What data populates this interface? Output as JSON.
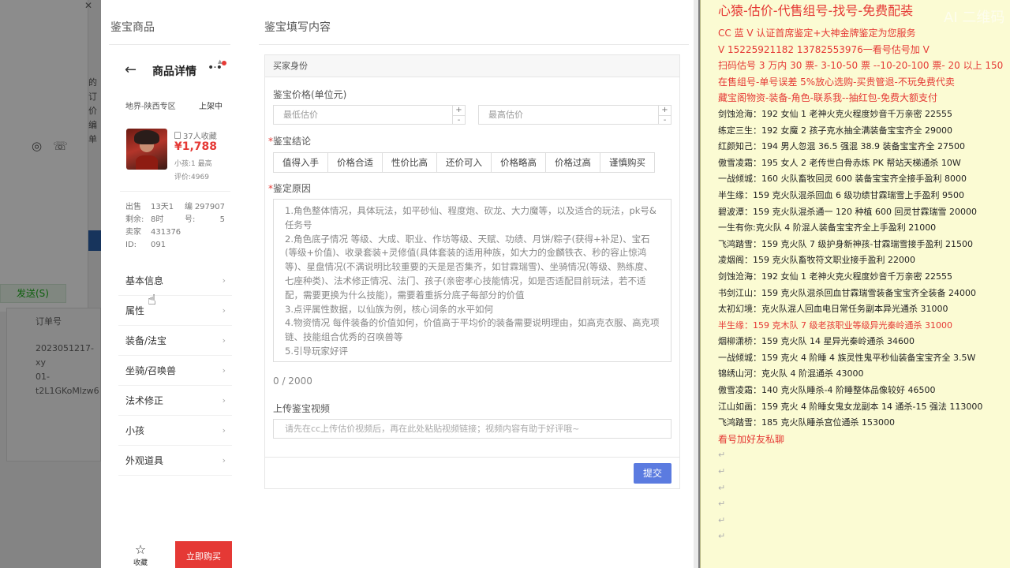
{
  "background": {
    "send_label": "发送(S)",
    "order_header": "订单号",
    "order_lines": [
      "2023051217-xy",
      "01-",
      "t2L1GKoMlzw6"
    ],
    "fragment_lines": [
      "的订",
      "",
      "",
      "价",
      "编",
      "",
      "单"
    ]
  },
  "dialog": {
    "left_title": "鉴宝商品",
    "right_title": "鉴宝填写内容",
    "phone": {
      "title": "商品详情",
      "region": "地界-陕西专区",
      "status": "上架中",
      "fav_count": "37人收藏",
      "price": "¥1,788",
      "kid_line": "小孩:1 最高",
      "score_line": "评价:4969",
      "stats": [
        {
          "a": "出售",
          "b": "13天1",
          "c": "编",
          "d": "297907"
        },
        {
          "a": "剩余:",
          "b": "8时",
          "c": "号:",
          "d": "5"
        },
        {
          "a": "卖家",
          "b": "431376",
          "c": "",
          "d": ""
        },
        {
          "a": "ID:",
          "b": "091",
          "c": "",
          "d": ""
        }
      ],
      "menu": [
        "基本信息",
        "属性",
        "装备/法宝",
        "坐骑/召唤兽",
        "法术修正",
        "小孩",
        "外观道具"
      ],
      "fav_label": "收藏",
      "buy_label": "立即购买"
    },
    "form": {
      "section_header": "买家身份",
      "price_label": "鉴宝价格(单位元)",
      "min_placeholder": "最低估价",
      "max_placeholder": "最高估价",
      "verdict_label": "鉴宝结论",
      "verdicts": [
        "值得入手",
        "价格合适",
        "性价比高",
        "还价可入",
        "价格略高",
        "价格过高",
        "谨慎购买"
      ],
      "reason_label": "鉴定原因",
      "reason_lines": [
        "1.角色整体情况，具体玩法，如平砂仙、程度炮、砍龙、大力魔等，以及适合的玩法，pk号&任务号",
        "2.角色底子情况 等级、大成、职业、作坊等级、天赋、功绩、月饼/粽子(获得+补足)、宝石(等级+价值)、收录套装+灵修值(具体套装的适用种族，如大力的金麟铁衣、秒的容止惊鸿等)、星盘情况(不满说明比较重要的天是是否集齐，如甘霖瑞雪)、坐骑情况(等级、熟练度、七座种类)、法术修正情况、法门、孩子(亲密孝心技能情况，如是否适配目前玩法，若不适配，需要更换为什么技能)，需要着重拆分底子每部分的价值",
        "3.点评属性数据，以仙族为例，核心词条的水平如何",
        "4.物资情况 每件装备的价值如何，价值高于平均价的装备需要说明理由，如高克衣服、高克项链、技能组合优秀的召唤兽等",
        "5.引导玩家好评"
      ],
      "counter": "0 / 2000",
      "video_label": "上传鉴宝视频",
      "video_placeholder": "请先在cc上传估价视频后，再在此处粘贴视频链接；视频内容有助于好评哦~",
      "submit_label": "提交"
    }
  },
  "note": {
    "title": "心猿-估价-代售组号-找号-免费配装",
    "watermark": "AI 二维码",
    "lines": [
      {
        "text": "CC 蓝 V 认证首席鉴定+大神金牌鉴定为您服务",
        "style": "red"
      },
      {
        "text": "V 15225921182      13782553976一看号估号加 V",
        "style": "red"
      },
      {
        "text": "扫码估号 3 万内 30 票- 3-10-50 票  --10-20-100 票- 20 以上 150",
        "style": "red"
      },
      {
        "text": "在售组号-单号误差 5%放心选购-买贵管退-不玩免费代卖",
        "style": "red"
      },
      {
        "text": "藏宝阁物资-装备-角色-联系我--抽红包-免费大额支付",
        "style": "red"
      },
      {
        "text": "剑蚀沧海：192 女仙 1 老神火克火程度妙音千万亲密 22555",
        "style": ""
      },
      {
        "text": "练定三生：192 女魔 2 孩子克水抽全满装备宝宝齐全 29000",
        "style": ""
      },
      {
        "text": "红颜知己：194 男人忽混 36.5 强混 38.9 装备宝宝齐全 27500",
        "style": ""
      },
      {
        "text": "傲雪凌霜：195 女人 2 老传世白骨赤炼 PK 帮站天梯通杀 10W",
        "style": ""
      },
      {
        "text": "一战倾城：160 火队畜牧回灵 600 装备宝宝齐全接手盈利 8000",
        "style": ""
      },
      {
        "text": "半生缘：159 克火队混杀回血 6 级功绩甘霖瑞雪上手盈利 9500",
        "style": ""
      },
      {
        "text": "碧波潭：159 克火队混杀通一 120 种植 600 回灵甘霖瑞雪 20000",
        "style": ""
      },
      {
        "text": "一生有你:克火队 4 阶混人装备宝宝齐全上手盈利 21000",
        "style": ""
      },
      {
        "text": "飞鸿踏雪：159 克火队 7 级护身新神孩-甘霖瑞雪接手盈利 21500",
        "style": ""
      },
      {
        "text": "凌烟阁：159 克火队畜牧符文职业接手盈利 22000",
        "style": ""
      },
      {
        "text": "剑蚀沧海：192 女仙 1 老神火克火程度妙音千万亲密 22555",
        "style": ""
      },
      {
        "text": "书剑江山：159 克火队混杀回血甘霖瑞雪装备宝宝齐全装备 24000",
        "style": ""
      },
      {
        "text": "太初幻境：克火队混人回血电日常任务副本异光通杀 31000",
        "style": ""
      },
      {
        "text": "半生缘：159 克木队 7 级老孩职业等级异光秦岭通杀 31000",
        "style": "red-small"
      },
      {
        "text": "烟柳潇桥：159 克火队 14 星异光秦岭通杀 34600",
        "style": ""
      },
      {
        "text": "一战倾城：159 克火 4 阶睡 4 族灵性鬼平秒仙装备宝宝齐全 3.5W",
        "style": ""
      },
      {
        "text": "锦绣山河：克火队 4 阶混通杀 43000",
        "style": ""
      },
      {
        "text": "傲雪凌霜：140 克火队睡杀-4 阶睡整体品像较好 46500",
        "style": ""
      },
      {
        "text": "江山如画：159 克火 4 阶睡女鬼女龙副本 14 通杀-15 强法 113000",
        "style": ""
      },
      {
        "text": "飞鸿踏雪：185 克火队睡杀宫位通杀 153000",
        "style": ""
      },
      {
        "text": "看号加好友私聊",
        "style": "red"
      }
    ]
  }
}
